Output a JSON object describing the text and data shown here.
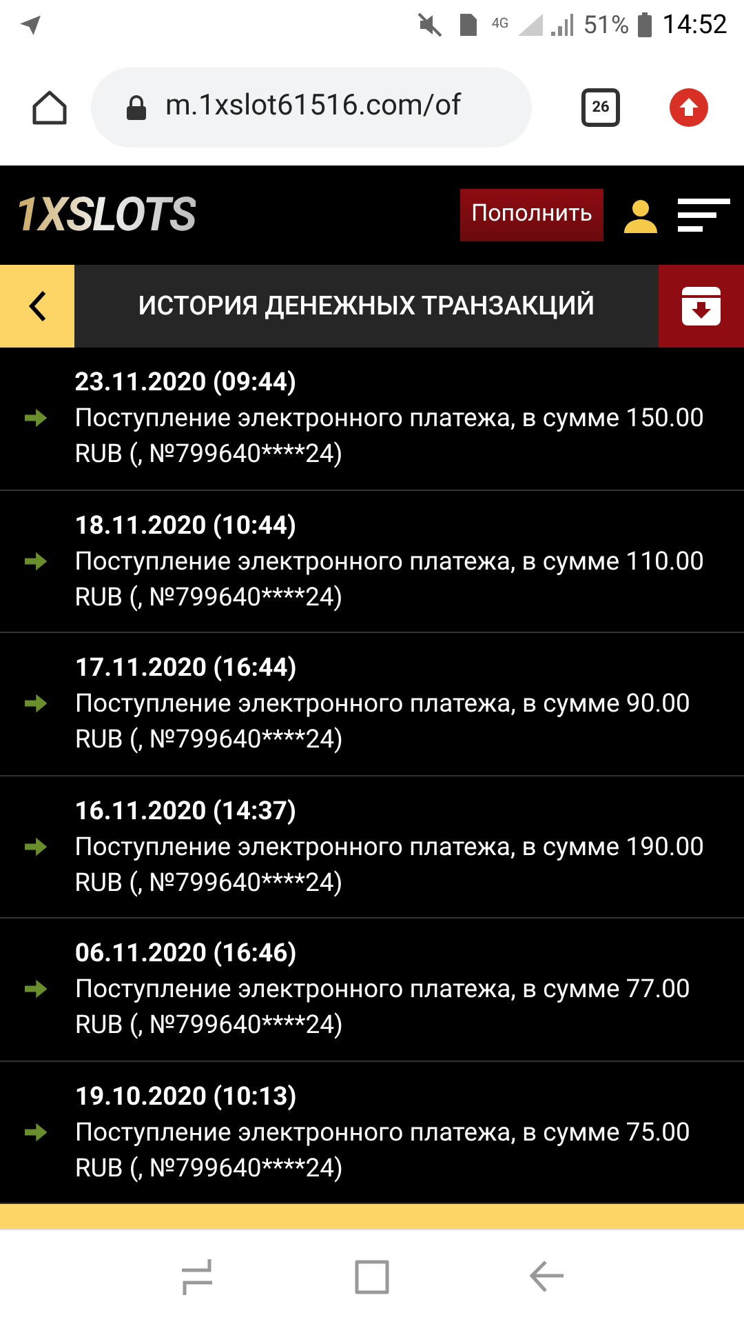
{
  "status_bar": {
    "network": "4G",
    "battery": "51%",
    "time": "14:52"
  },
  "browser": {
    "url": "m.1xslot61516.com/of",
    "tabs_count": "26"
  },
  "header": {
    "logo": "1XSLOTS",
    "deposit_button": "Пополнить"
  },
  "page_title": "ИСТОРИЯ ДЕНЕЖНЫХ ТРАНЗАКЦИЙ",
  "transactions": [
    {
      "date": "23.11.2020 (09:44)",
      "description": "Поступление электронного платежа, в сумме 150.00 RUB (, №799640****24)"
    },
    {
      "date": "18.11.2020 (10:44)",
      "description": "Поступление электронного платежа, в сумме 110.00 RUB (, №799640****24)"
    },
    {
      "date": "17.11.2020 (16:44)",
      "description": "Поступление электронного платежа, в сумме 90.00 RUB (, №799640****24)"
    },
    {
      "date": "16.11.2020 (14:37)",
      "description": "Поступление электронного платежа, в сумме 190.00 RUB (, №799640****24)"
    },
    {
      "date": "06.11.2020 (16:46)",
      "description": "Поступление электронного платежа, в сумме 77.00 RUB (, №799640****24)"
    },
    {
      "date": "19.10.2020 (10:13)",
      "description": "Поступление электронного платежа, в сумме 75.00 RUB (, №799640****24)"
    }
  ]
}
